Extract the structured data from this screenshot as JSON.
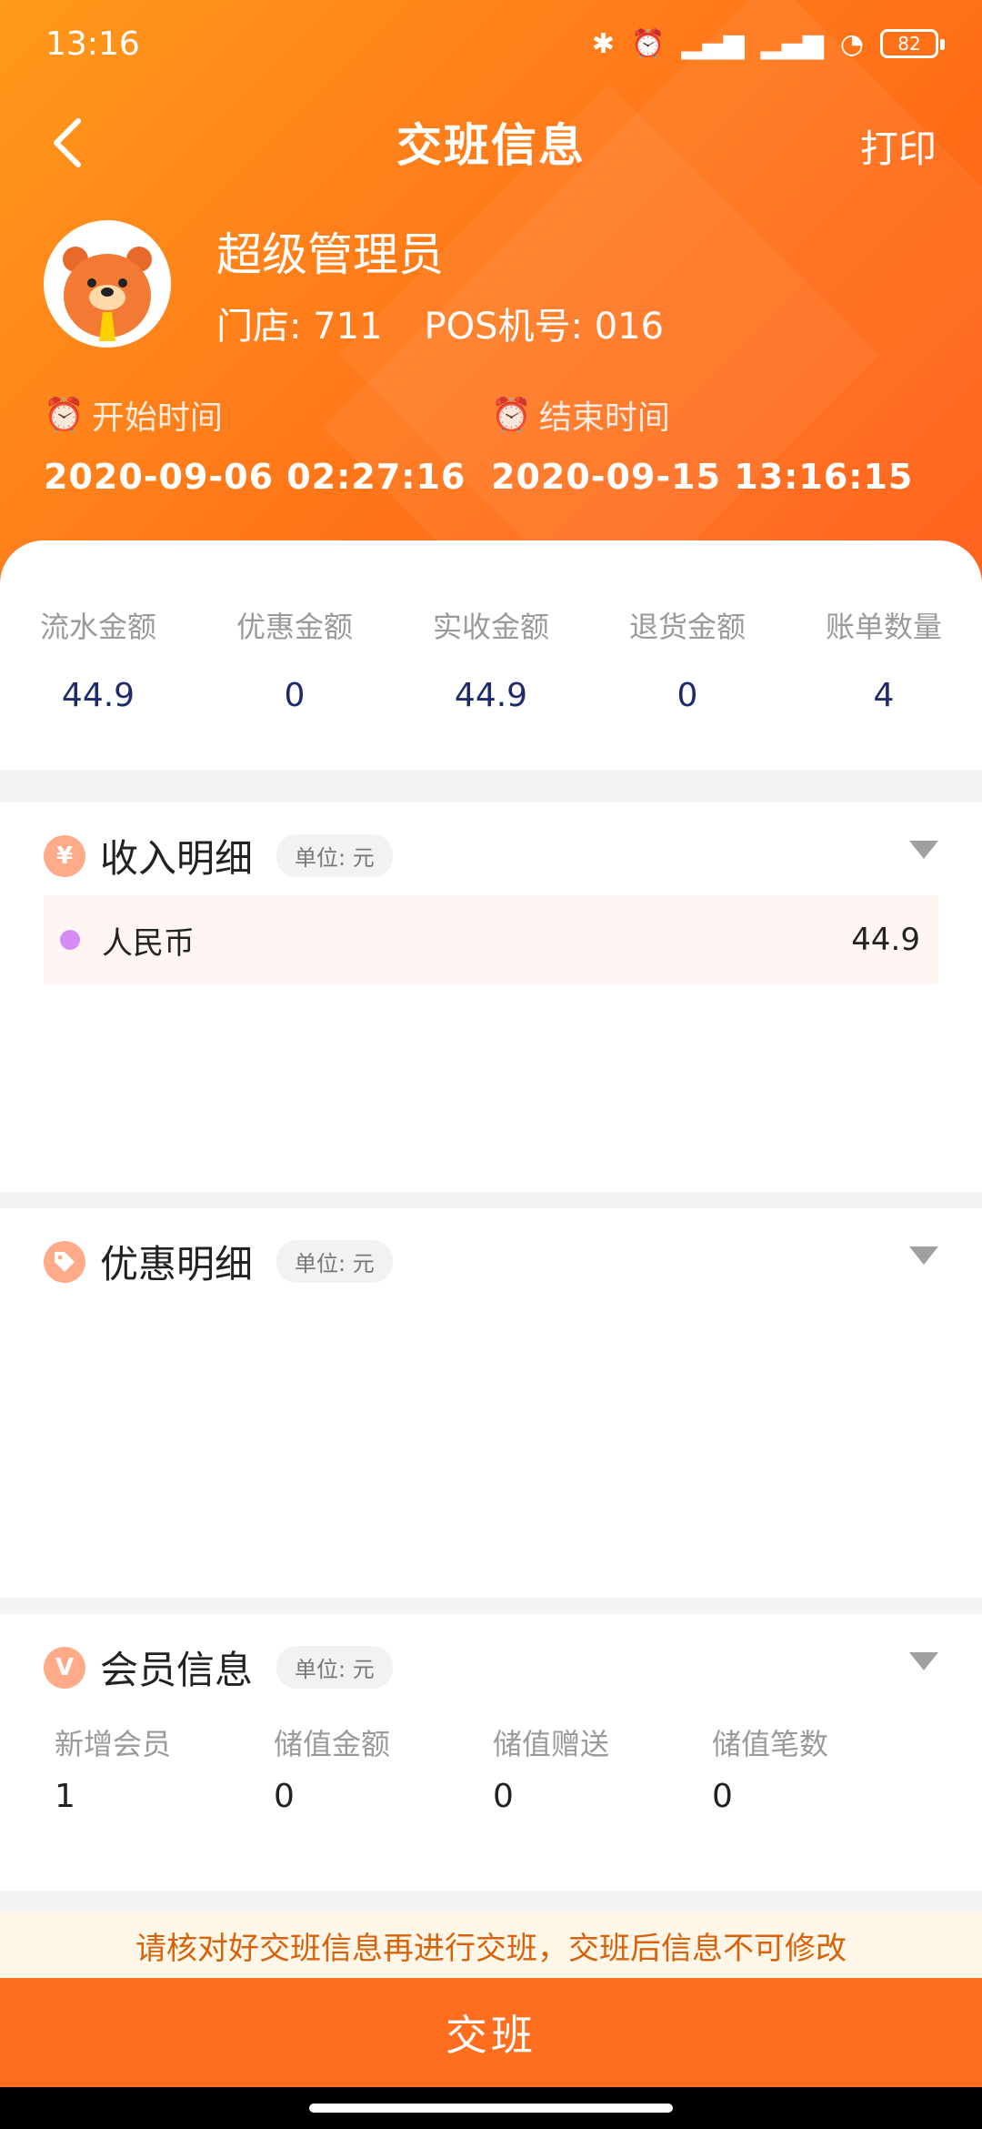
{
  "status": {
    "time": "13:16",
    "battery": "82"
  },
  "nav": {
    "title": "交班信息",
    "print_label": "打印"
  },
  "profile": {
    "name": "超级管理员",
    "store": "门店: 711",
    "pos": "POS机号: 016"
  },
  "times": {
    "start_label": "开始时间",
    "start_value": "2020-09-06 02:27:16",
    "end_label": "结束时间",
    "end_value": "2020-09-15 13:16:15"
  },
  "summary": [
    {
      "label": "流水金额",
      "value": "44.9"
    },
    {
      "label": "优惠金额",
      "value": "0"
    },
    {
      "label": "实收金额",
      "value": "44.9"
    },
    {
      "label": "退货金额",
      "value": "0"
    },
    {
      "label": "账单数量",
      "value": "4"
    }
  ],
  "income": {
    "title": "收入明细",
    "unit": "单位: 元",
    "icon": "yen-icon",
    "rows": [
      {
        "name": "人民币",
        "value": "44.9"
      }
    ]
  },
  "discount": {
    "title": "优惠明细",
    "unit": "单位: 元",
    "icon": "tag-icon"
  },
  "member": {
    "title": "会员信息",
    "unit": "单位: 元",
    "icon": "v-icon",
    "items": [
      {
        "label": "新增会员",
        "value": "1"
      },
      {
        "label": "储值金额",
        "value": "0"
      },
      {
        "label": "储值赠送",
        "value": "0"
      },
      {
        "label": "储值笔数",
        "value": "0"
      }
    ]
  },
  "notice": "请核对好交班信息再进行交班，交班后信息不可修改",
  "submit_label": "交班",
  "colors": {
    "accent": "#ff6d1f",
    "header_start": "#ff9a1a",
    "value_navy": "#1e2a6b",
    "notice_text": "#d7620c"
  }
}
